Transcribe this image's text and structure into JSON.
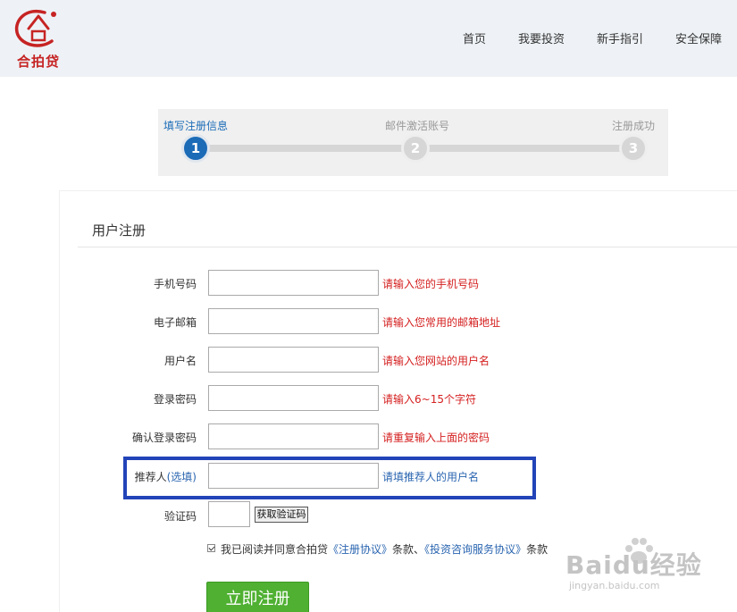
{
  "header": {
    "logo_text": "合拍贷",
    "nav": [
      "首页",
      "我要投资",
      "新手指引",
      "安全保障"
    ]
  },
  "steps": [
    {
      "label": "填写注册信息",
      "number": "1",
      "active": true
    },
    {
      "label": "邮件激活账号",
      "number": "2",
      "active": false
    },
    {
      "label": "注册成功",
      "number": "3",
      "active": false
    }
  ],
  "form": {
    "title": "用户注册",
    "fields": [
      {
        "label": "手机号码",
        "hint": "请输入您的手机号码",
        "value": ""
      },
      {
        "label": "电子邮箱",
        "hint": "请输入您常用的邮箱地址",
        "value": ""
      },
      {
        "label": "用户名",
        "hint": "请输入您网站的用户名",
        "value": ""
      },
      {
        "label": "登录密码",
        "hint": "请输入6~15个字符",
        "value": ""
      },
      {
        "label": "确认登录密码",
        "hint": "请重复输入上面的密码",
        "value": ""
      }
    ],
    "referrer": {
      "label": "推荐人",
      "optional": "(选填)",
      "hint": "请填推荐人的用户名",
      "value": ""
    },
    "captcha": {
      "label": "验证码",
      "button": "获取验证码",
      "value": ""
    },
    "agreement": {
      "prefix": "我已阅读并同意合拍贷",
      "link1": "《注册协议》",
      "middle": "条款、",
      "link2": "《投资咨询服务协议》",
      "suffix": "条款",
      "checked": true
    },
    "submit": "立即注册"
  },
  "watermark": {
    "main": "Baidu经验",
    "sub": "jingyan.baidu.com"
  },
  "colors": {
    "accent": "#1b6bb7",
    "error": "#d52020",
    "link": "#2a65b0",
    "submit": "#4fb032",
    "highlight": "#2244b8",
    "logo": "#c62323"
  }
}
